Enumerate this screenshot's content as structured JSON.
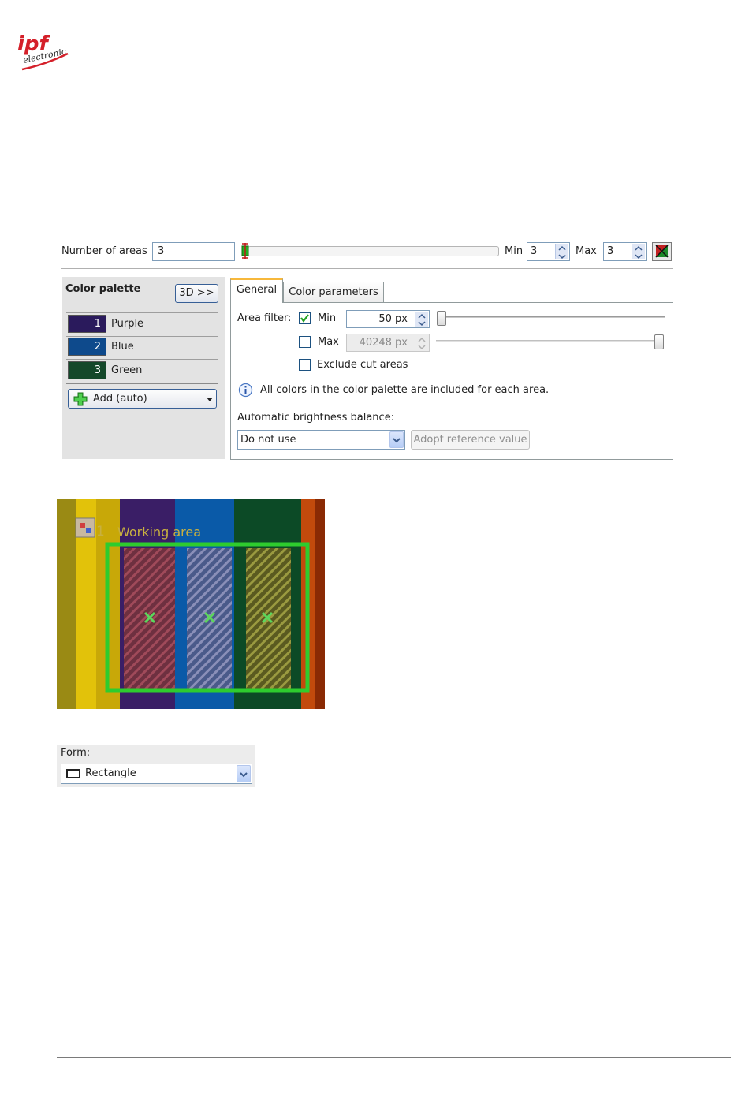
{
  "logo": {
    "text": "ipf",
    "subtext": "electronic",
    "color": "#d4202a"
  },
  "areas": {
    "label": "Number of areas",
    "value": "3",
    "min_label": "Min",
    "min_value": "3",
    "max_label": "Max",
    "max_value": "3"
  },
  "palette": {
    "title": "Color palette",
    "btn_3d": "3D >>",
    "items": [
      {
        "index": "1",
        "name": "Purple",
        "color": "#2a1a5c"
      },
      {
        "index": "2",
        "name": "Blue",
        "color": "#0e4a8c"
      },
      {
        "index": "3",
        "name": "Green",
        "color": "#14482a"
      }
    ],
    "add_label": "Add (auto)"
  },
  "tabs": [
    {
      "label": "General",
      "active": true
    },
    {
      "label": "Color parameters",
      "active": false
    }
  ],
  "general": {
    "area_filter_label": "Area filter:",
    "min_label": "Min",
    "min_checked": true,
    "min_value": "50 px",
    "max_label": "Max",
    "max_checked": false,
    "max_value": "40248 px",
    "exclude_label": "Exclude cut areas",
    "info_text": "All colors in the color palette are included for each area.",
    "brightness_label": "Automatic brightness balance:",
    "brightness_value": "Do not use",
    "adopt_label": "Adopt reference value"
  },
  "camera": {
    "area_index": "1",
    "area_label": "Working area"
  },
  "form": {
    "label": "Form:",
    "value": "Rectangle"
  }
}
